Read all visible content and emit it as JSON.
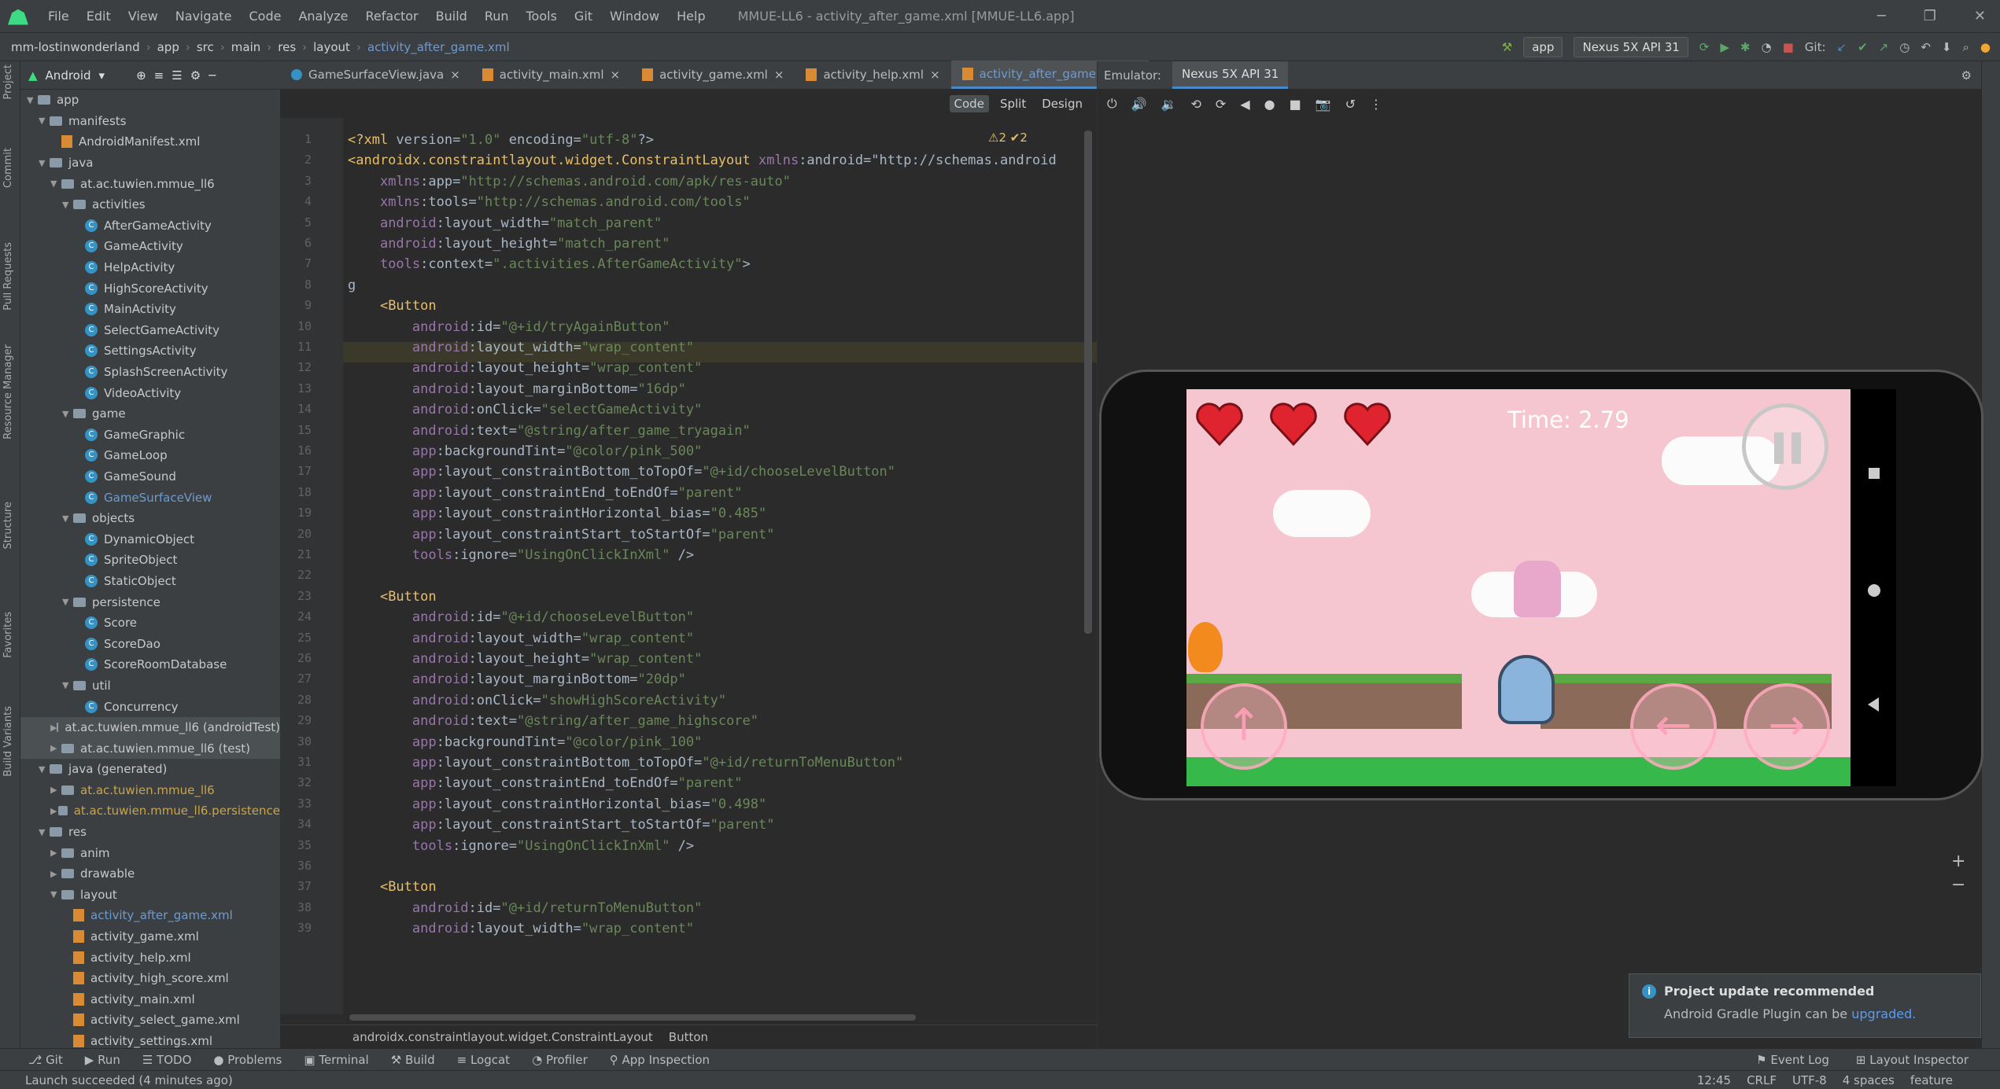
{
  "menubar": {
    "items": [
      "File",
      "Edit",
      "View",
      "Navigate",
      "Code",
      "Analyze",
      "Refactor",
      "Build",
      "Run",
      "Tools",
      "Git",
      "Window",
      "Help"
    ],
    "window_title": "MMUE-LL6 - activity_after_game.xml [MMUE-LL6.app]"
  },
  "navbar": {
    "crumbs": [
      "mm-lostinwonderland",
      "app",
      "src",
      "main",
      "res",
      "layout"
    ],
    "file": "activity_after_game.xml",
    "run_config": "app",
    "device": "Nexus 5X API 31",
    "git_label": "Git:"
  },
  "project": {
    "view": "Android",
    "tree": [
      {
        "label": "app",
        "type": "folder",
        "depth": 0
      },
      {
        "label": "manifests",
        "type": "folder",
        "depth": 1
      },
      {
        "label": "AndroidManifest.xml",
        "type": "xml",
        "depth": 2
      },
      {
        "label": "java",
        "type": "folder",
        "depth": 1
      },
      {
        "label": "at.ac.tuwien.mmue_ll6",
        "type": "folder",
        "depth": 2
      },
      {
        "label": "activities",
        "type": "folder",
        "depth": 3
      },
      {
        "label": "AfterGameActivity",
        "type": "class",
        "depth": 4
      },
      {
        "label": "GameActivity",
        "type": "class",
        "depth": 4
      },
      {
        "label": "HelpActivity",
        "type": "class",
        "depth": 4
      },
      {
        "label": "HighScoreActivity",
        "type": "class",
        "depth": 4
      },
      {
        "label": "MainActivity",
        "type": "class",
        "depth": 4
      },
      {
        "label": "SelectGameActivity",
        "type": "class",
        "depth": 4
      },
      {
        "label": "SettingsActivity",
        "type": "class",
        "depth": 4
      },
      {
        "label": "SplashScreenActivity",
        "type": "class",
        "depth": 4
      },
      {
        "label": "VideoActivity",
        "type": "class",
        "depth": 4
      },
      {
        "label": "game",
        "type": "folder",
        "depth": 3
      },
      {
        "label": "GameGraphic",
        "type": "class",
        "depth": 4
      },
      {
        "label": "GameLoop",
        "type": "class",
        "depth": 4
      },
      {
        "label": "GameSound",
        "type": "class",
        "depth": 4
      },
      {
        "label": "GameSurfaceView",
        "type": "class",
        "depth": 4,
        "style": "blue"
      },
      {
        "label": "objects",
        "type": "folder",
        "depth": 3
      },
      {
        "label": "DynamicObject",
        "type": "class",
        "depth": 4
      },
      {
        "label": "SpriteObject",
        "type": "class",
        "depth": 4
      },
      {
        "label": "StaticObject",
        "type": "class",
        "depth": 4
      },
      {
        "label": "persistence",
        "type": "folder",
        "depth": 3
      },
      {
        "label": "Score",
        "type": "class",
        "depth": 4
      },
      {
        "label": "ScoreDao",
        "type": "class",
        "depth": 4
      },
      {
        "label": "ScoreRoomDatabase",
        "type": "class",
        "depth": 4
      },
      {
        "label": "util",
        "type": "folder",
        "depth": 3
      },
      {
        "label": "Concurrency",
        "type": "class",
        "depth": 4
      },
      {
        "label": "at.ac.tuwien.mmue_ll6 (androidTest)",
        "type": "folder",
        "depth": 2,
        "sel": true
      },
      {
        "label": "at.ac.tuwien.mmue_ll6 (test)",
        "type": "folder",
        "depth": 2,
        "sel": true
      },
      {
        "label": "java (generated)",
        "type": "folder",
        "depth": 1
      },
      {
        "label": "at.ac.tuwien.mmue_ll6",
        "type": "folder",
        "depth": 2,
        "style": "gen"
      },
      {
        "label": "at.ac.tuwien.mmue_ll6.persistence",
        "type": "folder",
        "depth": 2,
        "style": "gen"
      },
      {
        "label": "res",
        "type": "folder",
        "depth": 1
      },
      {
        "label": "anim",
        "type": "folder",
        "depth": 2
      },
      {
        "label": "drawable",
        "type": "folder",
        "depth": 2
      },
      {
        "label": "layout",
        "type": "folder",
        "depth": 2
      },
      {
        "label": "activity_after_game.xml",
        "type": "xml",
        "depth": 3,
        "style": "blue"
      },
      {
        "label": "activity_game.xml",
        "type": "xml",
        "depth": 3
      },
      {
        "label": "activity_help.xml",
        "type": "xml",
        "depth": 3
      },
      {
        "label": "activity_high_score.xml",
        "type": "xml",
        "depth": 3
      },
      {
        "label": "activity_main.xml",
        "type": "xml",
        "depth": 3
      },
      {
        "label": "activity_select_game.xml",
        "type": "xml",
        "depth": 3
      },
      {
        "label": "activity_settings.xml",
        "type": "xml",
        "depth": 3
      }
    ]
  },
  "editor": {
    "tabs": [
      {
        "label": "GameSurfaceView.java",
        "kind": "java"
      },
      {
        "label": "activity_main.xml",
        "kind": "xml"
      },
      {
        "label": "activity_game.xml",
        "kind": "xml"
      },
      {
        "label": "activity_help.xml",
        "kind": "xml"
      },
      {
        "label": "activity_after_game.xml",
        "kind": "xml",
        "active": true
      }
    ],
    "view_modes": [
      "Code",
      "Split",
      "Design"
    ],
    "inspections": "⚠2 ✔2",
    "lines": [
      "<?xml version=\"1.0\" encoding=\"utf-8\"?>",
      "<androidx.constraintlayout.widget.ConstraintLayout xmlns:android=\"http://schemas.android",
      "    xmlns:app=\"http://schemas.android.com/apk/res-auto\"",
      "    xmlns:tools=\"http://schemas.android.com/tools\"",
      "    android:layout_width=\"match_parent\"",
      "    android:layout_height=\"match_parent\"",
      "    tools:context=\".activities.AfterGameActivity\">",
      "g",
      "    <Button",
      "        android:id=\"@+id/tryAgainButton\"",
      "        android:layout_width=\"wrap_content\"",
      "        android:layout_height=\"wrap_content\"",
      "        android:layout_marginBottom=\"16dp\"",
      "        android:onClick=\"selectGameActivity\"",
      "        android:text=\"@string/after_game_tryagain\"",
      "        app:backgroundTint=\"@color/pink_500\"",
      "        app:layout_constraintBottom_toTopOf=\"@+id/chooseLevelButton\"",
      "        app:layout_constraintEnd_toEndOf=\"parent\"",
      "        app:layout_constraintHorizontal_bias=\"0.485\"",
      "        app:layout_constraintStart_toStartOf=\"parent\"",
      "        tools:ignore=\"UsingOnClickInXml\" />",
      "",
      "    <Button",
      "        android:id=\"@+id/chooseLevelButton\"",
      "        android:layout_width=\"wrap_content\"",
      "        android:layout_height=\"wrap_content\"",
      "        android:layout_marginBottom=\"20dp\"",
      "        android:onClick=\"showHighScoreActivity\"",
      "        android:text=\"@string/after_game_highscore\"",
      "        app:backgroundTint=\"@color/pink_100\"",
      "        app:layout_constraintBottom_toTopOf=\"@+id/returnToMenuButton\"",
      "        app:layout_constraintEnd_toEndOf=\"parent\"",
      "        app:layout_constraintHorizontal_bias=\"0.498\"",
      "        app:layout_constraintStart_toStartOf=\"parent\"",
      "        tools:ignore=\"UsingOnClickInXml\" />",
      "",
      "    <Button",
      "        android:id=\"@+id/returnToMenuButton\"",
      "        android:layout_width=\"wrap_content\""
    ],
    "breadcrumb": [
      "androidx.constraintlayout.widget.ConstraintLayout",
      "Button"
    ]
  },
  "emulator": {
    "label": "Emulator:",
    "tab": "Nexus 5X API 31",
    "game": {
      "timer": "Time: 2.79",
      "hearts": 3
    }
  },
  "notification": {
    "title": "Project update recommended",
    "body": "Android Gradle Plugin can be",
    "link": "upgraded."
  },
  "bottom_tools": {
    "left": [
      "Git",
      "Run",
      "TODO",
      "Problems",
      "Terminal",
      "Build",
      "Logcat",
      "Profiler",
      "App Inspection"
    ],
    "right": [
      "Event Log",
      "Layout Inspector"
    ]
  },
  "status": {
    "message": "Launch succeeded (4 minutes ago)",
    "position": "12:45",
    "line_ending": "CRLF",
    "encoding": "UTF-8",
    "indent": "4 spaces",
    "branch": "feature"
  },
  "side_tabs": {
    "left": [
      "Project",
      "Commit",
      "Pull Requests",
      "Resource Manager",
      "Structure",
      "Favorites",
      "Build Variants"
    ]
  }
}
